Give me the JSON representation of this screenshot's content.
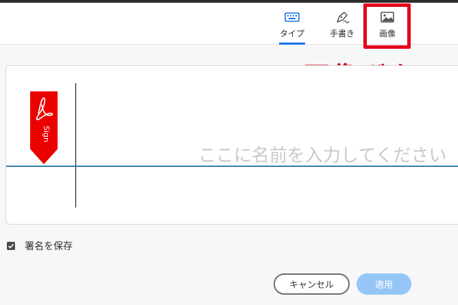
{
  "tabs": [
    {
      "label": "タイプ",
      "icon": "keyboard-icon",
      "selected": true
    },
    {
      "label": "手書き",
      "icon": "pen-icon",
      "selected": false
    },
    {
      "label": "画像",
      "icon": "image-icon",
      "selected": false
    }
  ],
  "annotation": {
    "text": "画像ボタン",
    "color": "#d7001a"
  },
  "sign_area": {
    "badge_text": "Sign",
    "placeholder": "ここに名前を入力してください"
  },
  "save_signature": {
    "label": "署名を保存",
    "checked": true
  },
  "buttons": {
    "cancel": "キャンセル",
    "apply": "適用"
  },
  "colors": {
    "accent": "#1473e6",
    "highlight": "#e5001b",
    "badge": "#eb0000"
  }
}
